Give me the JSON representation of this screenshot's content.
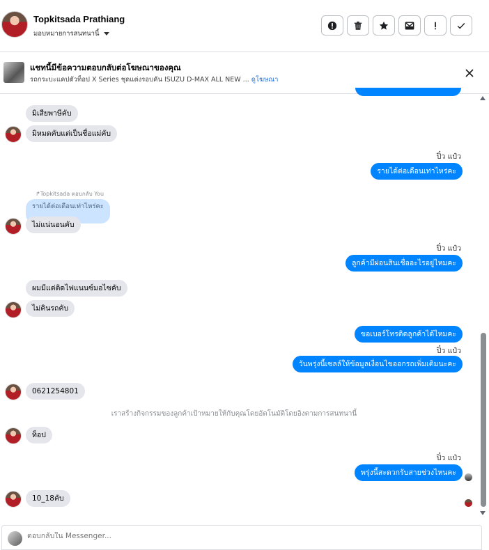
{
  "header": {
    "name": "Topkitsada Prathiang",
    "assign_label": "มอบหมายการสนทนานี้",
    "actions": [
      "report-icon",
      "trash-icon",
      "star-icon",
      "mail-icon",
      "exclamation-icon",
      "check-icon"
    ]
  },
  "ad": {
    "title": "แชทนี้มีข้อความตอบกลับต่อโฆษณาของคุณ",
    "subtitle": "รถกระบะแคปตัวท็อป X Series ชุดแต่งรอบคัน ISUZU D-MAX ALL NEW ...",
    "link": "ดูโฆษณา"
  },
  "messages": {
    "m1": "มิเสียพาษีคับ",
    "m2": "มิหมดคับแต่เป็นชื่อแม่คับ",
    "s1": "ปิ๋ว แป๋ว",
    "m3": "รายได้ต่อเดือนเท่าไหร่คะ",
    "reply_meta": "↱Topkitsada ตอบกลับ You",
    "quoted": "รายได้ต่อเดือนเท่าไหร่คะ",
    "m4": "ไม่แน่นอนคับ",
    "s2": "ปิ๋ว แป๋ว",
    "m5": "ลูกค้ามีผ่อนสินเชื่ออะไรอยู่ไหมคะ",
    "m6": "ผมมีแต่ติดไฟแนนซ์มอไซคับ",
    "m7": "ไม่คินรถคับ",
    "m8": "ขอเบอร์โทรติดลูกค้าได้ไหมคะ",
    "s3": "ปิ๋ว แป๋ว",
    "m9": "วันพรุ่งนี้เซลล์ให้ข้อมูลเงื่อนไขออกรถเพิ่มเติมนะคะ",
    "m10": "0621254801",
    "system": "เราสร้างกิจกรรมของลูกค้าเป้าหมายให้กับคุณโดยอัตโนมัติโดยอิงตามการสนทนานี้",
    "m11": "ท็อป",
    "s4": "ปิ๋ว แป๋ว",
    "m12": "พรุ่งนี้สะดวกรับสายช่วงไหนคะ",
    "m13": "10_18คับ"
  },
  "composer": {
    "placeholder": "ตอบกลับใน Messenger..."
  },
  "colors": {
    "outgoing": "#0084ff",
    "incoming": "#e4e6eb",
    "link": "#216fdb"
  }
}
